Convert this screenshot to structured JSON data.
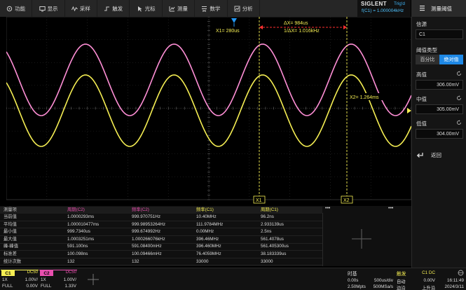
{
  "menu": [
    {
      "label": "功能",
      "icon": "function-icon"
    },
    {
      "label": "显示",
      "icon": "display-icon"
    },
    {
      "label": "采样",
      "icon": "acquire-icon"
    },
    {
      "label": "触发",
      "icon": "trigger-icon"
    },
    {
      "label": "光标",
      "icon": "cursor-icon"
    },
    {
      "label": "测量",
      "icon": "measure-icon"
    },
    {
      "label": "数学",
      "icon": "math-icon"
    },
    {
      "label": "分析",
      "icon": "analysis-icon"
    }
  ],
  "status": {
    "brand": "SIGLENT",
    "trigger_state": "Trig'd",
    "freq_readout": "f(C1) = 1.000004kHz"
  },
  "panel": {
    "title": "测量阈值",
    "source_label": "信源",
    "source_value": "C1",
    "type_label": "阈值类型",
    "type_percent": "百分比",
    "type_absolute": "绝对值",
    "high_label": "高值",
    "high_value": "306.00mV",
    "mid_label": "中值",
    "mid_value": "305.00mV",
    "low_label": "低值",
    "low_value": "304.00mV",
    "back_label": "返回"
  },
  "cursors": {
    "x1_label": "X1= 280us",
    "x2_label": "X2= 1.264ms",
    "dx_label": "ΔX= 984us",
    "inv_dx_label": "1/ΔX= 1.016kHz",
    "x1_tag": "X1",
    "x2_tag": "X2"
  },
  "markers": {
    "ch1": "C1",
    "ch2": "C2"
  },
  "colors": {
    "ch1": "#f5ee53",
    "ch2": "#ff8fd6",
    "cursor": "#f5ee53",
    "delta": "#ff3030",
    "trig_pointer": "#2196f3"
  },
  "measure": {
    "headers": [
      "测量项",
      "周期(C2)",
      "频率(C2)",
      "频率(C1)",
      "周期(C1)"
    ],
    "rows": [
      [
        "当前值",
        "1.0000293ms",
        "999.970751Hz",
        "10.40MHz",
        "96.2ns"
      ],
      [
        "平均值",
        "1.000010477ms",
        "999.98953264Hz",
        "111.9784MHz",
        "2.933139us"
      ],
      [
        "最小值",
        "999.7340us",
        "999.674992Hz",
        "0.00MHz",
        "2.5ns"
      ],
      [
        "最大值",
        "1.0003251ms",
        "1.000266076kHz",
        "396.46MHz",
        "561.4078us"
      ],
      [
        "峰-峰值",
        "591.100ns",
        "591.08400mHz",
        "396.460MHz",
        "561.405300us"
      ],
      [
        "标准差",
        "100.098ns",
        "100.09466mHz",
        "76.4059MHz",
        "38.183339us"
      ],
      [
        "统计次数",
        "132",
        "132",
        "33000",
        "33000"
      ]
    ],
    "more_a": "•••",
    "more_b": "•••"
  },
  "channels": {
    "ch1": {
      "tag": "C1",
      "coupling": "DC50",
      "probe": "1X",
      "scale": "1.00V/",
      "bw": "FULL",
      "offset": "0.00V"
    },
    "ch2": {
      "tag": "C2",
      "coupling": "DC50",
      "probe": "1X",
      "scale": "1.00V/",
      "bw": "FULL",
      "offset": "1.33V"
    }
  },
  "timebase": {
    "title": "时基",
    "delay": "0.00s",
    "scale": "500us/div",
    "points": "2.50Mpts",
    "rate": "500MSa/s"
  },
  "trigger": {
    "title": "触发",
    "source": "C1 DC",
    "mode": "自动",
    "level": "0.00V",
    "type": "边沿",
    "slope": "上升沿"
  },
  "clock": {
    "time": "16:11:49",
    "date": "2024/3/11"
  }
}
